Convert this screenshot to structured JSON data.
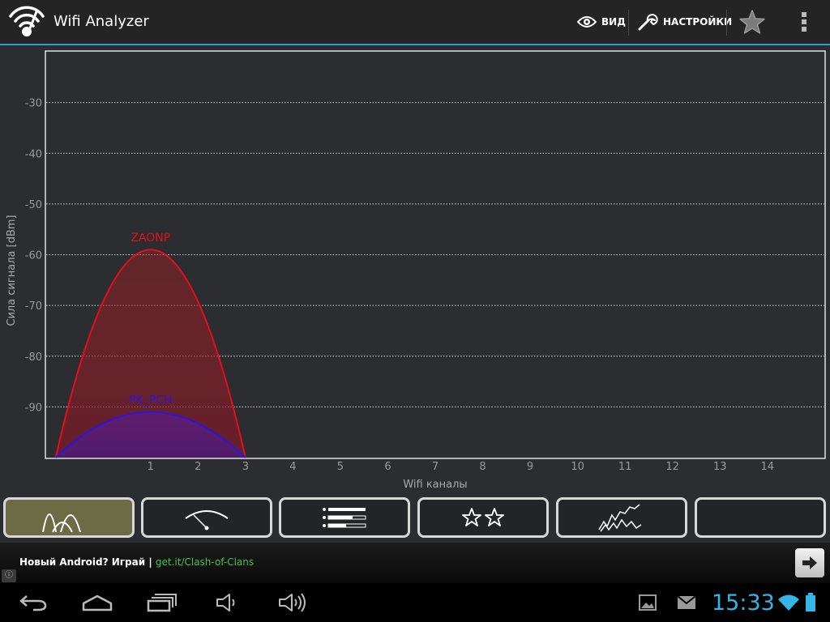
{
  "app": {
    "title": "Wifi Analyzer",
    "icon": "wifi-analyzer-app-icon"
  },
  "actionbar": {
    "view_label": "ВИД",
    "settings_label": "НАСТРОЙКИ",
    "view_icon": "eye-icon",
    "settings_icon": "wrench-icon",
    "star_icon": "star-icon",
    "overflow_icon": "overflow-menu-icon"
  },
  "chart_data": {
    "type": "area",
    "xlabel": "Wifi каналы",
    "ylabel": "Сила сигнала [dBm]",
    "ylim": [
      -100,
      -20
    ],
    "xlim": [
      -1.2,
      15.2
    ],
    "x_ticks": [
      1,
      2,
      3,
      4,
      5,
      6,
      7,
      8,
      9,
      10,
      11,
      12,
      13,
      14
    ],
    "y_ticks": [
      -30,
      -40,
      -50,
      -60,
      -70,
      -80,
      -90
    ],
    "grid": "horizontal dotted",
    "series": [
      {
        "name": "ZAONP",
        "channel": 1,
        "peak_dbm": -59,
        "span": [
          -1,
          3
        ],
        "color": "#e0101c"
      },
      {
        "name": "PK_PCH",
        "channel": 1,
        "peak_dbm": -91,
        "span": [
          -1,
          3
        ],
        "color": "#2a16e0"
      }
    ]
  },
  "tabs": [
    {
      "name": "channel-graph",
      "icon": "channel-graph-icon",
      "active": true
    },
    {
      "name": "signal-meter",
      "icon": "signal-meter-icon",
      "active": false
    },
    {
      "name": "ap-list",
      "icon": "ap-list-icon",
      "active": false
    },
    {
      "name": "channel-rating",
      "icon": "channel-rating-icon",
      "active": false
    },
    {
      "name": "time-graph",
      "icon": "time-graph-icon",
      "active": false
    },
    {
      "name": "empty-tab",
      "icon": "",
      "active": false
    }
  ],
  "ad": {
    "text": "Новый Android? Играй | ",
    "link": "get.it/Clash-of-Clans",
    "info_glyph": "ⓘ"
  },
  "system": {
    "clock": "15:33",
    "colors": {
      "accent": "#33b5e5",
      "background": "#2c2d31"
    }
  }
}
